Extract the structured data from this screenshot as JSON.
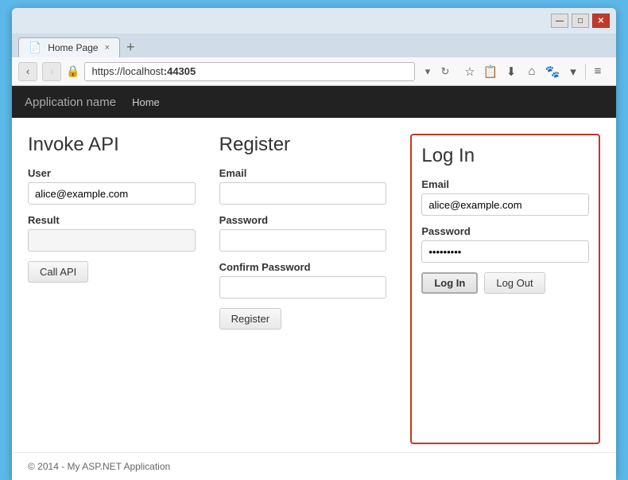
{
  "browser": {
    "tab_title": "Home Page",
    "tab_close": "×",
    "new_tab": "+",
    "url": "https://localhost",
    "port": ":44305",
    "back_icon": "‹",
    "forward_icon": "›",
    "lock_icon": "🔒",
    "refresh_icon": "↻",
    "dropdown_icon": "▾",
    "star_icon": "☆",
    "clip_icon": "📋",
    "download_icon": "⬇",
    "home_icon": "⌂",
    "bookmark_icon": "🐾",
    "menu_arrow": "▾",
    "hamburger": "≡",
    "minimize": "—",
    "maximize": "□",
    "close": "✕",
    "title_bar_title": "Home Page"
  },
  "navbar": {
    "app_name": "Application name",
    "nav_home": "Home"
  },
  "invoke_api": {
    "heading": "Invoke API",
    "user_label": "User",
    "user_placeholder": "alice@example.com",
    "user_value": "alice@example.com",
    "result_label": "Result",
    "result_value": "",
    "call_api_btn": "Call API"
  },
  "register": {
    "heading": "Register",
    "email_label": "Email",
    "email_value": "",
    "password_label": "Password",
    "password_value": "",
    "confirm_label": "Confirm Password",
    "confirm_value": "",
    "register_btn": "Register"
  },
  "login": {
    "heading": "Log In",
    "email_label": "Email",
    "email_value": "alice@example.com",
    "password_label": "Password",
    "password_value": "••••••••",
    "login_btn": "Log In",
    "logout_btn": "Log Out"
  },
  "footer": {
    "text": "© 2014 - My ASP.NET Application"
  }
}
